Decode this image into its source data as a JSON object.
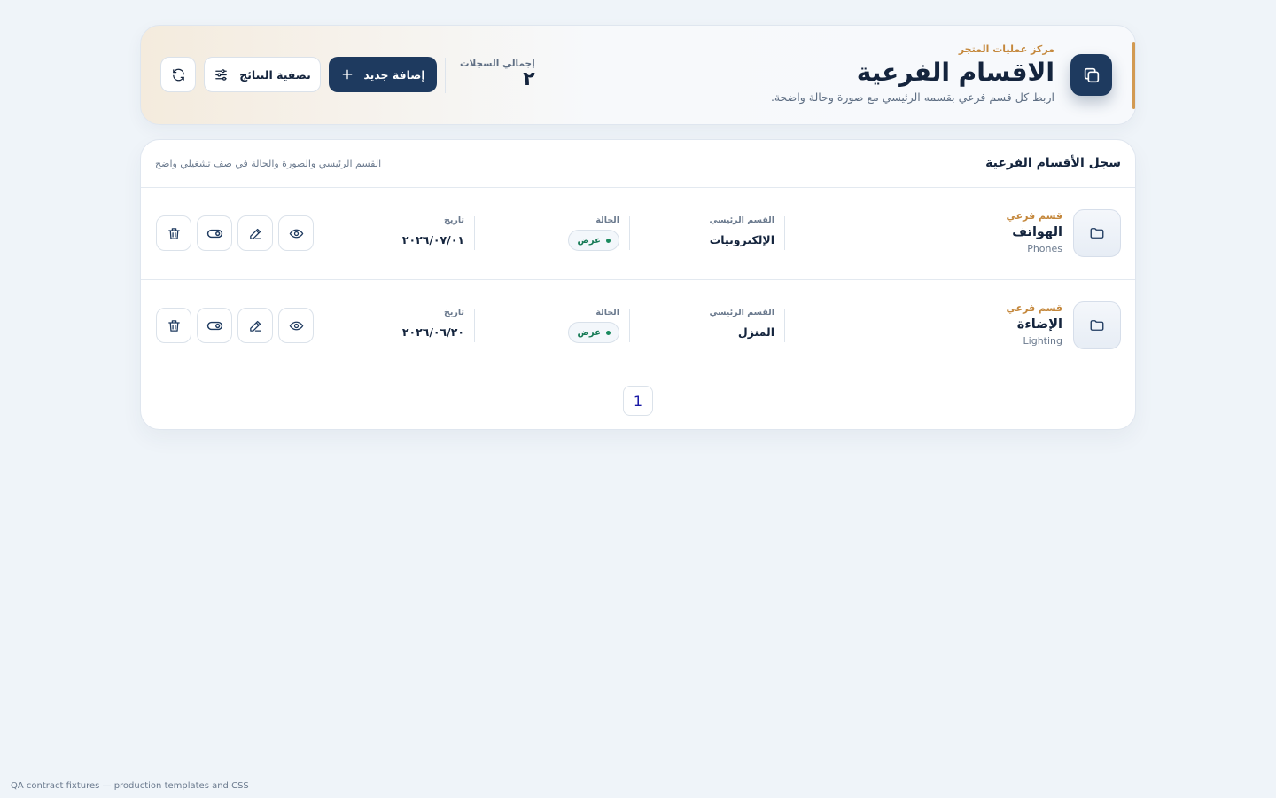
{
  "header": {
    "eyebrow": "مركز عمليات المتجر",
    "title": "الاقسام الفرعية",
    "subtitle": "اربط كل قسم فرعي بقسمه الرئيسي مع صورة وحالة واضحة.",
    "stat_label": "إجمالي السجلات",
    "stat_value": "٢",
    "add_label": "إضافة جديد",
    "filter_label": "تصفية النتائج",
    "icon": "copy-icon",
    "accent_color": "#d29a52",
    "primary_color": "#1e3a5f"
  },
  "table": {
    "title": "سجل الأقسام الفرعية",
    "note": "القسم الرئيسي والصورة والحالة في صف تشغيلي واضح",
    "labels": {
      "parent": "القسم الرئيسي",
      "status": "الحالة",
      "date": "تاريخ"
    },
    "rows": [
      {
        "tag": "قسم فرعي",
        "name": "الهواتف",
        "name_en": "Phones",
        "parent": "الإلكترونيات",
        "status": "عرض",
        "date": "٢٠٢٦/٠٧/٠١"
      },
      {
        "tag": "قسم فرعي",
        "name": "الإضاءة",
        "name_en": "Lighting",
        "parent": "المنزل",
        "status": "عرض",
        "date": "٢٠٢٦/٠٦/٢٠"
      }
    ],
    "status_color": "#167a55"
  },
  "pagination": {
    "current": "1"
  },
  "footer": {
    "note": "QA contract fixtures — production templates and CSS"
  }
}
